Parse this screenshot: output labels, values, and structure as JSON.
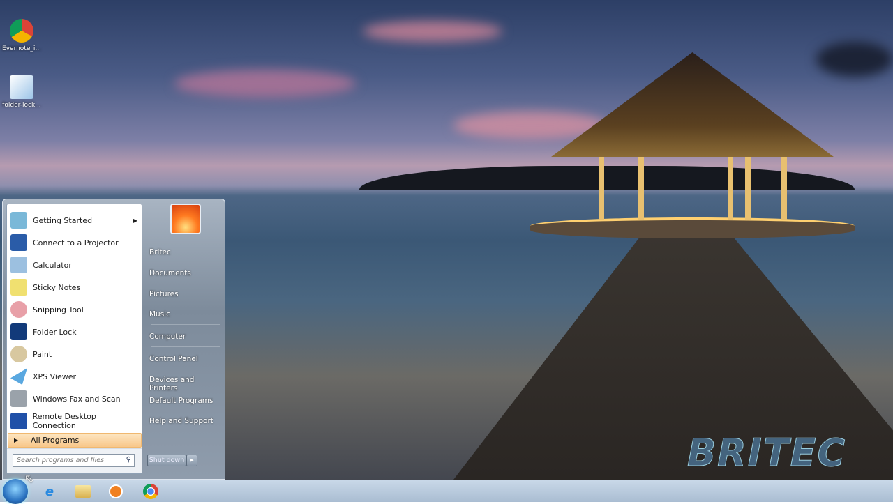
{
  "desktop": {
    "icons": [
      {
        "label": "Evernote_i...",
        "icon": "chrome-icon"
      },
      {
        "label": "folder-lock...",
        "icon": "installer-icon"
      }
    ],
    "watermark": "BRITEC"
  },
  "start_menu": {
    "programs": [
      {
        "label": "Getting Started",
        "icon": "getting-started-icon",
        "has_submenu": true
      },
      {
        "label": "Connect to a Projector",
        "icon": "projector-icon"
      },
      {
        "label": "Calculator",
        "icon": "calculator-icon"
      },
      {
        "label": "Sticky Notes",
        "icon": "sticky-notes-icon"
      },
      {
        "label": "Snipping Tool",
        "icon": "scissors-icon"
      },
      {
        "label": "Folder Lock",
        "icon": "key-icon"
      },
      {
        "label": "Paint",
        "icon": "palette-icon"
      },
      {
        "label": "XPS Viewer",
        "icon": "xps-icon"
      },
      {
        "label": "Windows Fax and Scan",
        "icon": "fax-icon"
      },
      {
        "label": "Remote Desktop Connection",
        "icon": "remote-desktop-icon"
      }
    ],
    "all_programs": "All Programs",
    "search_placeholder": "Search programs and files",
    "right_items": [
      "Britec",
      "Documents",
      "Pictures",
      "Music",
      "Computer",
      "Control Panel",
      "Devices and Printers",
      "Default Programs",
      "Help and Support"
    ],
    "shutdown": "Shut down"
  },
  "taskbar": {
    "items": [
      "start-orb",
      "internet-explorer",
      "windows-explorer",
      "media-player",
      "chrome"
    ]
  },
  "colors": {
    "all_programs_highlight": "#f8c78a",
    "taskbar": "#b9cadc"
  }
}
